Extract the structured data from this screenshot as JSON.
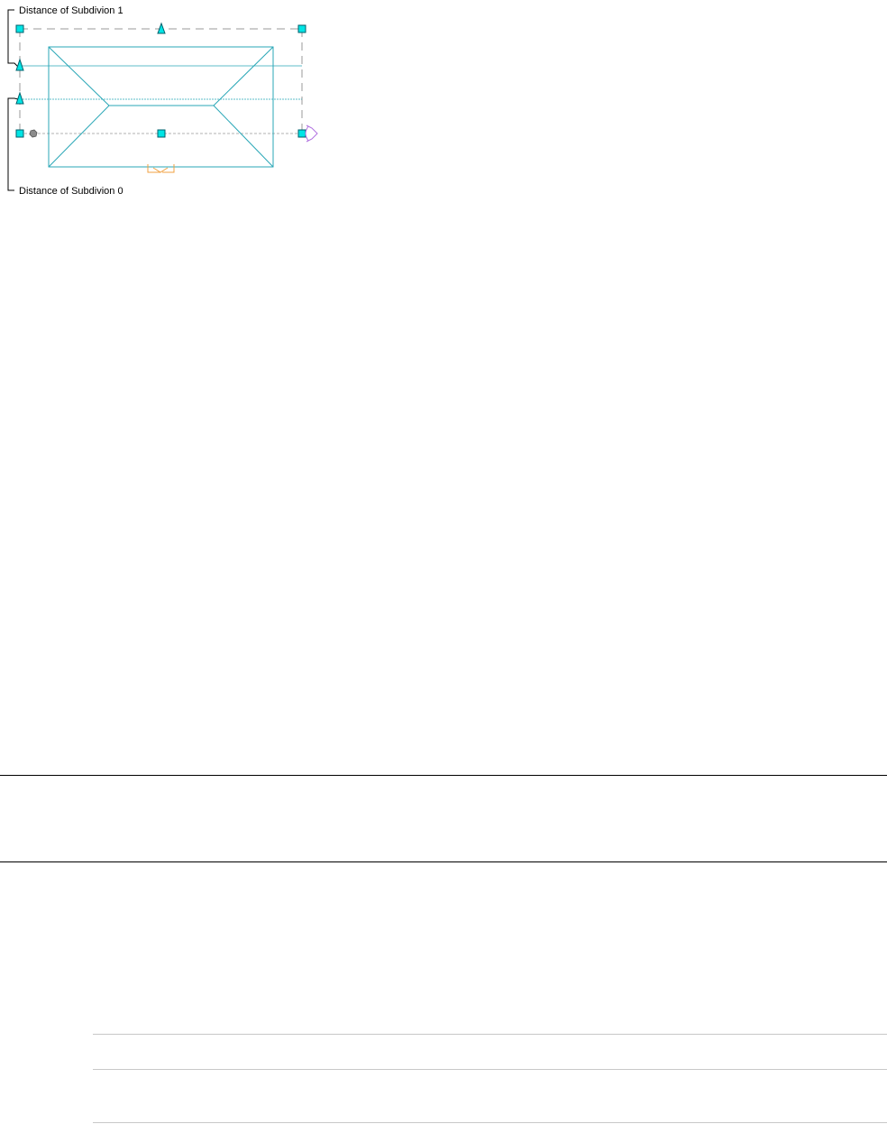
{
  "diagram": {
    "labels": {
      "subdivision_1": "Distance of Subdivion 1",
      "subdivision_0": "Distance of Subdivion 0"
    },
    "colors": {
      "roof_line": "#2aa7b7",
      "grip_fill": "#00e5e5",
      "grip_stroke": "#005f6b",
      "reference_line": "#9a9a9a",
      "bracket": "#000000",
      "gray_grip": "#8c8c8c",
      "purple_grip": "#b070e0",
      "orange_marker": "#f0a040"
    }
  }
}
